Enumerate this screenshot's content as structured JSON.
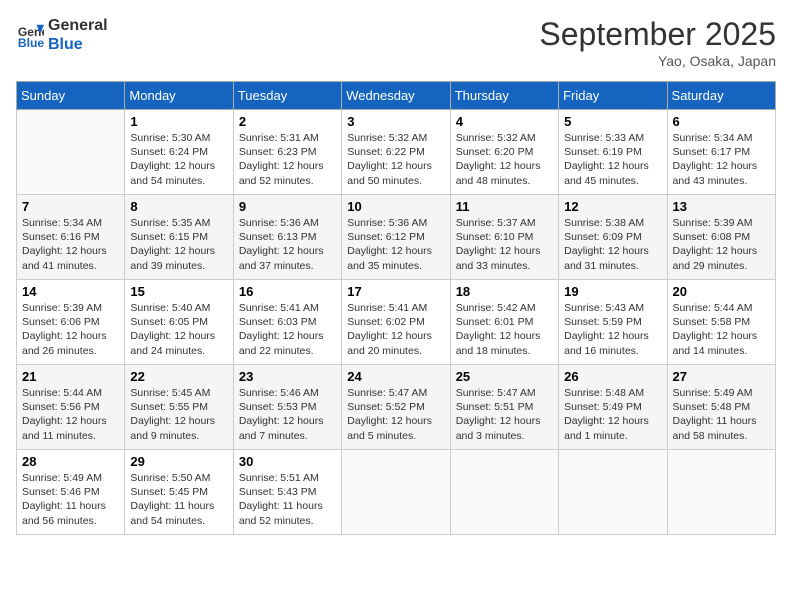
{
  "header": {
    "logo_line1": "General",
    "logo_line2": "Blue",
    "month": "September 2025",
    "location": "Yao, Osaka, Japan"
  },
  "weekdays": [
    "Sunday",
    "Monday",
    "Tuesday",
    "Wednesday",
    "Thursday",
    "Friday",
    "Saturday"
  ],
  "weeks": [
    [
      {
        "day": "",
        "info": ""
      },
      {
        "day": "1",
        "info": "Sunrise: 5:30 AM\nSunset: 6:24 PM\nDaylight: 12 hours\nand 54 minutes."
      },
      {
        "day": "2",
        "info": "Sunrise: 5:31 AM\nSunset: 6:23 PM\nDaylight: 12 hours\nand 52 minutes."
      },
      {
        "day": "3",
        "info": "Sunrise: 5:32 AM\nSunset: 6:22 PM\nDaylight: 12 hours\nand 50 minutes."
      },
      {
        "day": "4",
        "info": "Sunrise: 5:32 AM\nSunset: 6:20 PM\nDaylight: 12 hours\nand 48 minutes."
      },
      {
        "day": "5",
        "info": "Sunrise: 5:33 AM\nSunset: 6:19 PM\nDaylight: 12 hours\nand 45 minutes."
      },
      {
        "day": "6",
        "info": "Sunrise: 5:34 AM\nSunset: 6:17 PM\nDaylight: 12 hours\nand 43 minutes."
      }
    ],
    [
      {
        "day": "7",
        "info": "Sunrise: 5:34 AM\nSunset: 6:16 PM\nDaylight: 12 hours\nand 41 minutes."
      },
      {
        "day": "8",
        "info": "Sunrise: 5:35 AM\nSunset: 6:15 PM\nDaylight: 12 hours\nand 39 minutes."
      },
      {
        "day": "9",
        "info": "Sunrise: 5:36 AM\nSunset: 6:13 PM\nDaylight: 12 hours\nand 37 minutes."
      },
      {
        "day": "10",
        "info": "Sunrise: 5:36 AM\nSunset: 6:12 PM\nDaylight: 12 hours\nand 35 minutes."
      },
      {
        "day": "11",
        "info": "Sunrise: 5:37 AM\nSunset: 6:10 PM\nDaylight: 12 hours\nand 33 minutes."
      },
      {
        "day": "12",
        "info": "Sunrise: 5:38 AM\nSunset: 6:09 PM\nDaylight: 12 hours\nand 31 minutes."
      },
      {
        "day": "13",
        "info": "Sunrise: 5:39 AM\nSunset: 6:08 PM\nDaylight: 12 hours\nand 29 minutes."
      }
    ],
    [
      {
        "day": "14",
        "info": "Sunrise: 5:39 AM\nSunset: 6:06 PM\nDaylight: 12 hours\nand 26 minutes."
      },
      {
        "day": "15",
        "info": "Sunrise: 5:40 AM\nSunset: 6:05 PM\nDaylight: 12 hours\nand 24 minutes."
      },
      {
        "day": "16",
        "info": "Sunrise: 5:41 AM\nSunset: 6:03 PM\nDaylight: 12 hours\nand 22 minutes."
      },
      {
        "day": "17",
        "info": "Sunrise: 5:41 AM\nSunset: 6:02 PM\nDaylight: 12 hours\nand 20 minutes."
      },
      {
        "day": "18",
        "info": "Sunrise: 5:42 AM\nSunset: 6:01 PM\nDaylight: 12 hours\nand 18 minutes."
      },
      {
        "day": "19",
        "info": "Sunrise: 5:43 AM\nSunset: 5:59 PM\nDaylight: 12 hours\nand 16 minutes."
      },
      {
        "day": "20",
        "info": "Sunrise: 5:44 AM\nSunset: 5:58 PM\nDaylight: 12 hours\nand 14 minutes."
      }
    ],
    [
      {
        "day": "21",
        "info": "Sunrise: 5:44 AM\nSunset: 5:56 PM\nDaylight: 12 hours\nand 11 minutes."
      },
      {
        "day": "22",
        "info": "Sunrise: 5:45 AM\nSunset: 5:55 PM\nDaylight: 12 hours\nand 9 minutes."
      },
      {
        "day": "23",
        "info": "Sunrise: 5:46 AM\nSunset: 5:53 PM\nDaylight: 12 hours\nand 7 minutes."
      },
      {
        "day": "24",
        "info": "Sunrise: 5:47 AM\nSunset: 5:52 PM\nDaylight: 12 hours\nand 5 minutes."
      },
      {
        "day": "25",
        "info": "Sunrise: 5:47 AM\nSunset: 5:51 PM\nDaylight: 12 hours\nand 3 minutes."
      },
      {
        "day": "26",
        "info": "Sunrise: 5:48 AM\nSunset: 5:49 PM\nDaylight: 12 hours\nand 1 minute."
      },
      {
        "day": "27",
        "info": "Sunrise: 5:49 AM\nSunset: 5:48 PM\nDaylight: 11 hours\nand 58 minutes."
      }
    ],
    [
      {
        "day": "28",
        "info": "Sunrise: 5:49 AM\nSunset: 5:46 PM\nDaylight: 11 hours\nand 56 minutes."
      },
      {
        "day": "29",
        "info": "Sunrise: 5:50 AM\nSunset: 5:45 PM\nDaylight: 11 hours\nand 54 minutes."
      },
      {
        "day": "30",
        "info": "Sunrise: 5:51 AM\nSunset: 5:43 PM\nDaylight: 11 hours\nand 52 minutes."
      },
      {
        "day": "",
        "info": ""
      },
      {
        "day": "",
        "info": ""
      },
      {
        "day": "",
        "info": ""
      },
      {
        "day": "",
        "info": ""
      }
    ]
  ]
}
